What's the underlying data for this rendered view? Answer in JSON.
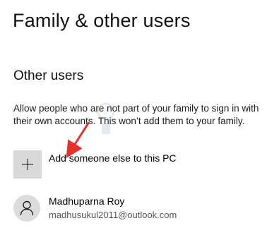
{
  "header": {
    "title": "Family & other users"
  },
  "other_users": {
    "section_title": "Other users",
    "description_line1": "Allow people who are not part of your family to sign in with",
    "description_line2": "their own accounts. This won’t add them to your family.",
    "add_button_label": "Add someone else to this PC",
    "add_icon": "plus-icon",
    "users": [
      {
        "name": "Madhuparna Roy",
        "email": "madhusukul2011@outlook.com",
        "avatar_icon": "person-icon"
      }
    ]
  },
  "colors": {
    "tile_background": "#d9d9d9",
    "avatar_background": "#dcdcdc",
    "annotation_arrow": "#e8302c"
  },
  "decorations": {
    "watermark_text": "©TheGeekPage.com"
  }
}
